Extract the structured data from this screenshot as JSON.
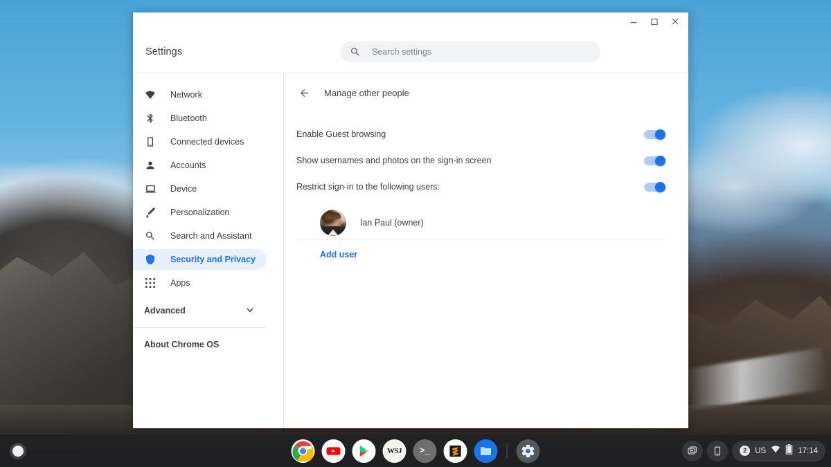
{
  "window": {
    "app_title": "Settings",
    "controls": {
      "minimize": "minimize-window",
      "maximize": "maximize-window",
      "close": "close-window"
    }
  },
  "search": {
    "placeholder": "Search settings",
    "value": "",
    "icon": "search-icon"
  },
  "sidebar": {
    "items": [
      {
        "label": "Network",
        "icon": "wifi-icon",
        "selected": false
      },
      {
        "label": "Bluetooth",
        "icon": "bluetooth-icon",
        "selected": false
      },
      {
        "label": "Connected devices",
        "icon": "phone-icon",
        "selected": false
      },
      {
        "label": "Accounts",
        "icon": "person-icon",
        "selected": false
      },
      {
        "label": "Device",
        "icon": "laptop-icon",
        "selected": false
      },
      {
        "label": "Personalization",
        "icon": "brush-icon",
        "selected": false
      },
      {
        "label": "Search and Assistant",
        "icon": "search-icon",
        "selected": false
      },
      {
        "label": "Security and Privacy",
        "icon": "shield-icon",
        "selected": true
      },
      {
        "label": "Apps",
        "icon": "grid-apps-icon",
        "selected": false
      }
    ],
    "advanced": {
      "label": "Advanced",
      "icon": "chevron-down-icon"
    },
    "about": {
      "label": "About Chrome OS"
    }
  },
  "content": {
    "back_icon": "back-arrow-icon",
    "title": "Manage other people",
    "settings": [
      {
        "label": "Enable Guest browsing",
        "toggle_on": true
      },
      {
        "label": "Show usernames and photos on the sign-in screen",
        "toggle_on": true
      },
      {
        "label": "Restrict sign-in to the following users:",
        "toggle_on": true
      }
    ],
    "users": [
      {
        "name": "Ian Paul (owner)",
        "avatar": "user-photo"
      }
    ],
    "add_user_label": "Add user"
  },
  "shelf": {
    "launcher": "launcher-button",
    "apps": [
      {
        "name": "Chrome",
        "icon": "chrome-icon",
        "active": false
      },
      {
        "name": "YouTube",
        "icon": "youtube-icon",
        "active": false
      },
      {
        "name": "Play Store",
        "icon": "play-store-icon",
        "active": false
      },
      {
        "name": "WSJ",
        "icon": "wsj-icon",
        "active": false
      },
      {
        "name": "Terminal",
        "icon": "terminal-icon",
        "active": false
      },
      {
        "name": "Sublime Text",
        "icon": "sublime-text-icon",
        "active": false
      },
      {
        "name": "Files",
        "icon": "files-icon",
        "active": false
      },
      {
        "name": "Settings",
        "icon": "gear-icon",
        "active": true
      }
    ],
    "tray": {
      "screen_capture_icon": "screen-capture-icon",
      "phone_hub_icon": "phone-hub-icon",
      "notification_count": "2",
      "keyboard_layout": "US",
      "wifi_icon": "wifi-icon",
      "battery_icon": "battery-icon",
      "time": "17:14"
    }
  },
  "colors": {
    "accent_blue": "#1a73e8",
    "toggle_track": "#aecbfa",
    "selected_bg": "#e8f0fe",
    "text_primary": "#3c4043",
    "shelf_bg": "#202124"
  }
}
